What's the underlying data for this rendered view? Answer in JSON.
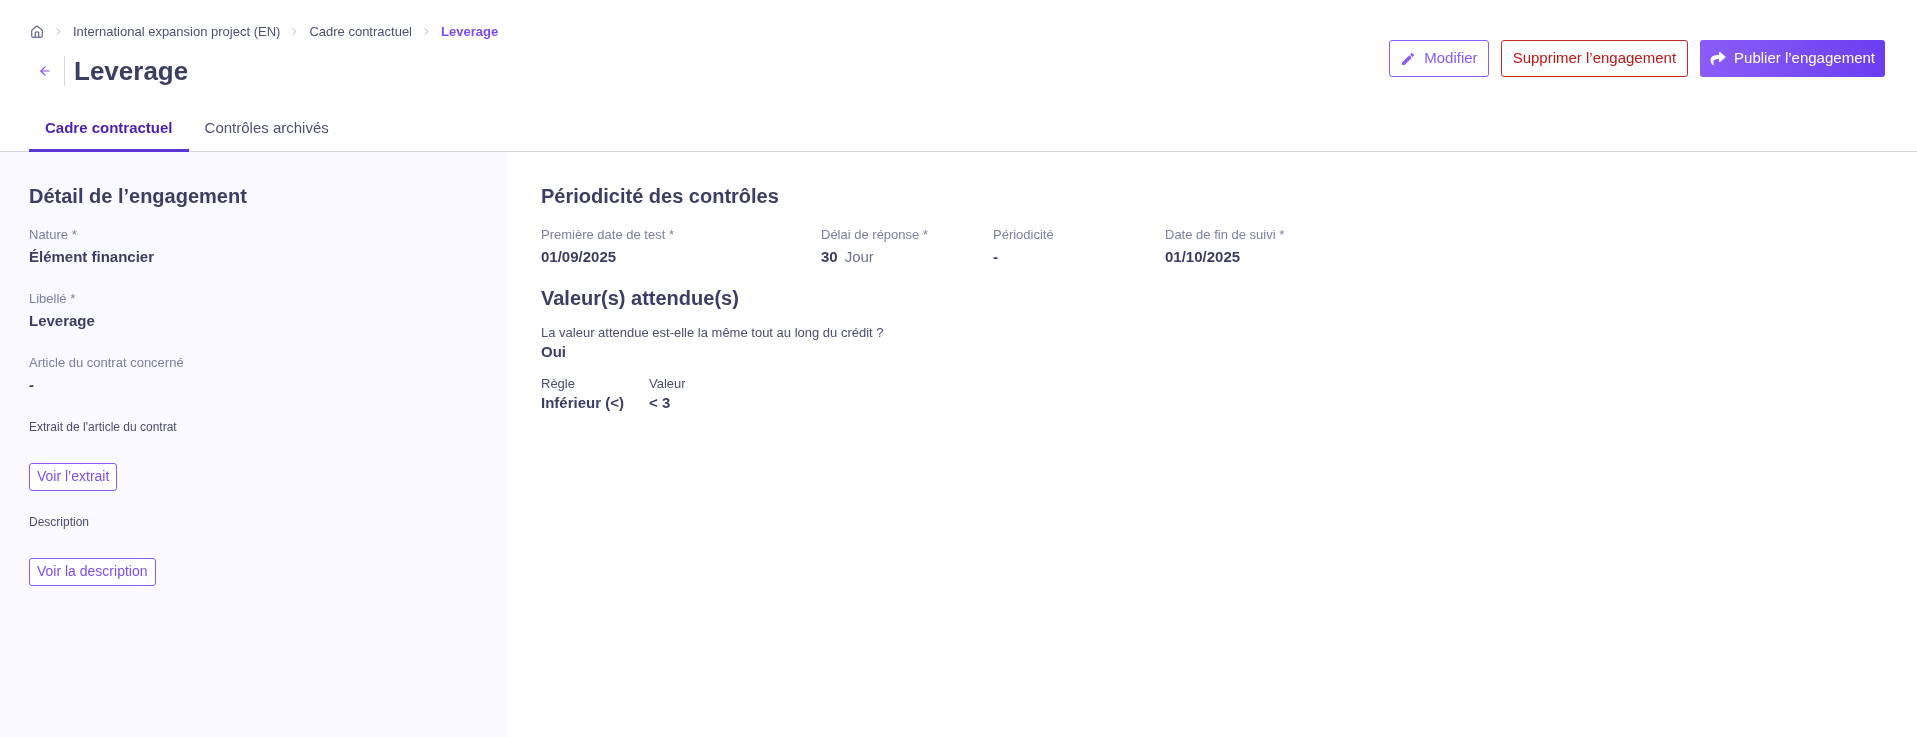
{
  "breadcrumb": [
    {
      "label": "International expansion project (EN)",
      "current": false
    },
    {
      "label": "Cadre contractuel",
      "current": false
    },
    {
      "label": "Leverage",
      "current": true
    }
  ],
  "page": {
    "title": "Leverage"
  },
  "actions": [
    {
      "kind": "edit",
      "label": "Modifier"
    },
    {
      "kind": "danger",
      "label": "Supprimer l’engagement"
    },
    {
      "kind": "primary",
      "label": "Publier l’engagement"
    }
  ],
  "tabs": [
    {
      "label": "Cadre contractuel",
      "selected": true
    },
    {
      "label": "Contrôles archivés",
      "selected": false
    }
  ],
  "detail": {
    "title": "Détail de l’engagement",
    "fields": [
      {
        "kind": "value",
        "label": "Nature *",
        "value": "Élément financier"
      },
      {
        "kind": "value",
        "label": "Libellé *",
        "value": "Leverage"
      },
      {
        "kind": "value",
        "label": "Article du contrat concerné",
        "value": "-"
      },
      {
        "kind": "button",
        "label": "Extrait de l'article du contrat",
        "button": "Voir l’extrait"
      },
      {
        "kind": "button",
        "label": "Description",
        "button": "Voir la description"
      }
    ]
  },
  "periodicity": {
    "title": "Périodicité des contrôles",
    "fields": [
      {
        "label": "Première date de test *",
        "value": "01/09/2025"
      },
      {
        "label": "Délai de réponse *",
        "value": "30",
        "unit": "Jour"
      },
      {
        "label": "Périodicité",
        "value": "-"
      },
      {
        "label": "Date de fin de suivi *",
        "value": "01/10/2025"
      }
    ]
  },
  "expected_values": {
    "title": "Valeur(s) attendue(s)",
    "question": {
      "label": "La valeur attendue est-elle la même tout au long du crédit ?",
      "value": "Oui"
    },
    "fields": [
      {
        "label": "Règle",
        "value": "Inférieur (<)"
      },
      {
        "label": "Valeur",
        "value": "< 3"
      }
    ]
  }
}
